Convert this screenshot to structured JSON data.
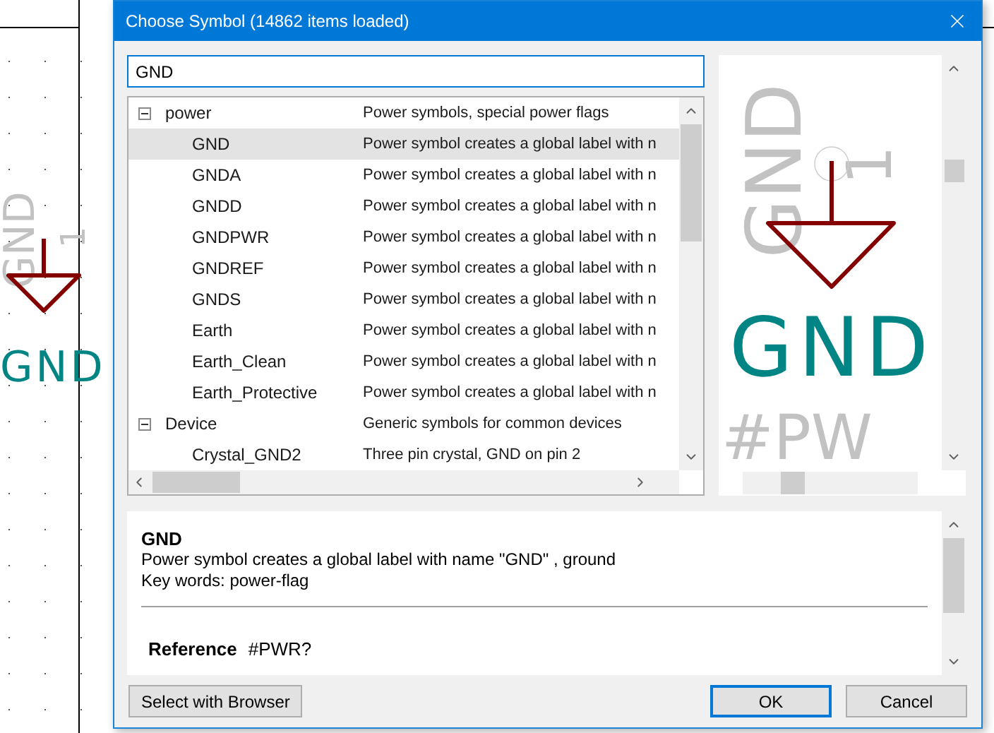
{
  "schematic": {
    "pin_name": "GND",
    "pin_number": "1",
    "value": "GND"
  },
  "window": {
    "title": "Choose Symbol (14862 items loaded)"
  },
  "search": {
    "value": "GND"
  },
  "tree": [
    {
      "name": "power",
      "description": "Power symbols, special power flags",
      "expanded": true,
      "children": [
        {
          "name": "GND",
          "description": "Power symbol creates a global label with n",
          "selected": true
        },
        {
          "name": "GNDA",
          "description": "Power symbol creates a global label with n",
          "selected": false
        },
        {
          "name": "GNDD",
          "description": "Power symbol creates a global label with n",
          "selected": false
        },
        {
          "name": "GNDPWR",
          "description": "Power symbol creates a global label with n",
          "selected": false
        },
        {
          "name": "GNDREF",
          "description": "Power symbol creates a global label with n",
          "selected": false
        },
        {
          "name": "GNDS",
          "description": "Power symbol creates a global label with n",
          "selected": false
        },
        {
          "name": "Earth",
          "description": "Power symbol creates a global label with n",
          "selected": false
        },
        {
          "name": "Earth_Clean",
          "description": "Power symbol creates a global label with n",
          "selected": false
        },
        {
          "name": "Earth_Protective",
          "description": "Power symbol creates a global label with n",
          "selected": false
        }
      ]
    },
    {
      "name": "Device",
      "description": "Generic symbols for common devices",
      "expanded": true,
      "children": [
        {
          "name": "Crystal_GND2",
          "description": "Three pin crystal, GND on pin 2",
          "selected": false
        }
      ]
    }
  ],
  "preview": {
    "pin_name": "GND",
    "pin_number": "1",
    "value": "GND",
    "reference": "#PW"
  },
  "details": {
    "name": "GND",
    "description": "Power symbol creates a global label with name \"GND\" , ground",
    "keywords": "Key words: power-flag",
    "reference_label": "Reference",
    "reference_value": "#PWR?"
  },
  "buttons": {
    "browser": "Select with Browser",
    "ok": "OK",
    "cancel": "Cancel"
  }
}
